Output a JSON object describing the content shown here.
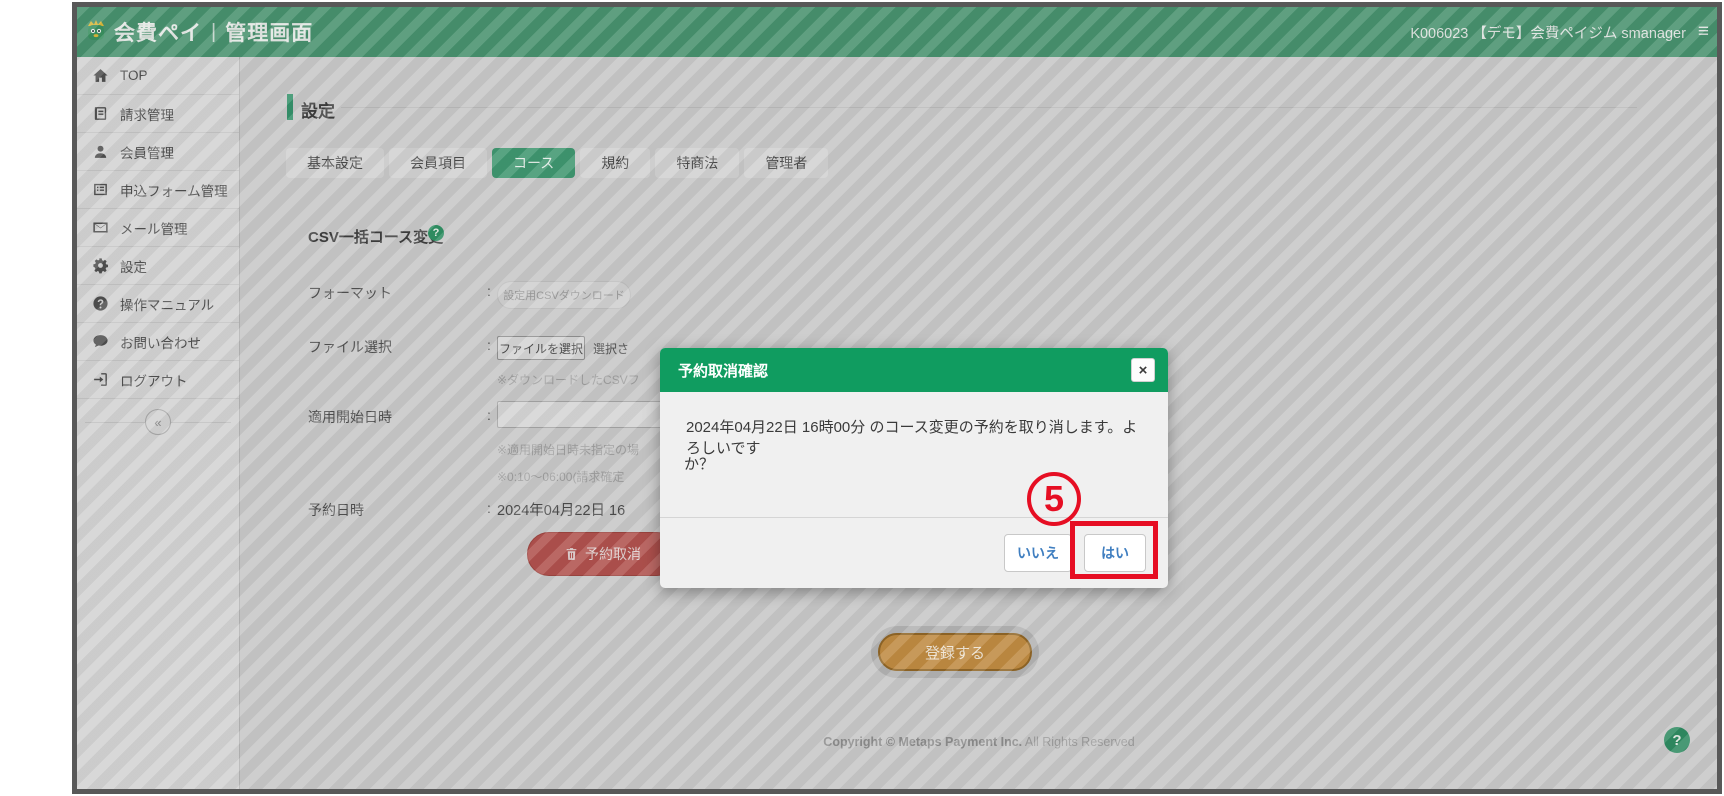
{
  "window_header": {
    "brand": "会費ペイ",
    "divider": "|",
    "screen_title": "管理画面",
    "account": "K006023 【デモ】会費ペイジム smanager",
    "menu_glyph": "≡"
  },
  "sidebar": {
    "items": [
      {
        "label": "TOP"
      },
      {
        "label": "請求管理"
      },
      {
        "label": "会員管理"
      },
      {
        "label": "申込フォーム管理"
      },
      {
        "label": "メール管理"
      },
      {
        "label": "設定"
      },
      {
        "label": "操作マニュアル"
      },
      {
        "label": "お問い合わせ"
      },
      {
        "label": "ログアウト"
      }
    ],
    "collapse_glyph": "«"
  },
  "settings": {
    "section_title": "設定",
    "tabs": [
      {
        "label": "基本設定"
      },
      {
        "label": "会員項目"
      },
      {
        "label": "コース"
      },
      {
        "label": "規約"
      },
      {
        "label": "特商法"
      },
      {
        "label": "管理者"
      }
    ],
    "active_tab": "コース",
    "subsection_title": "CSV一括コース変更",
    "help_glyph": "?",
    "colon": ":",
    "format_label": "フォーマット",
    "format_button": "設定用CSVダウンロード",
    "file_label": "ファイル選択",
    "file_button": "ファイルを選択",
    "file_status": "選択さ",
    "file_note": "※ダウンロードしたCSVフ",
    "start_label": "適用開始日時",
    "start_note1": "※適用開始日時未指定の場",
    "start_note2": "※0:10～06:00(請求確定",
    "reserved_label": "予約日時",
    "reserved_value": "2024年04月22日 16",
    "cancel_button": "予約取消",
    "submit_button": "登録する"
  },
  "modal": {
    "title": "予約取消確認",
    "close_glyph": "×",
    "body_line1": "2024年04月22日 16時00分 のコース変更の予約を取り消します。よろしいです",
    "body_line2": "か？",
    "no_button": "いいえ",
    "yes_button": "はい"
  },
  "annotation": {
    "step": "5"
  },
  "footer": {
    "copyright_strong": "Copyright © Metaps Payment Inc.",
    "copyright_rest": " All Rights Reserved",
    "help_glyph": "?"
  },
  "colors": {
    "header_green": "#47916d",
    "modal_green": "#109c60",
    "accent_green": "#35916a",
    "annotation_red": "#e60e23",
    "danger_red": "#b0514d",
    "submit_orange": "#bf8a41",
    "link_blue": "#3f7ec0"
  }
}
